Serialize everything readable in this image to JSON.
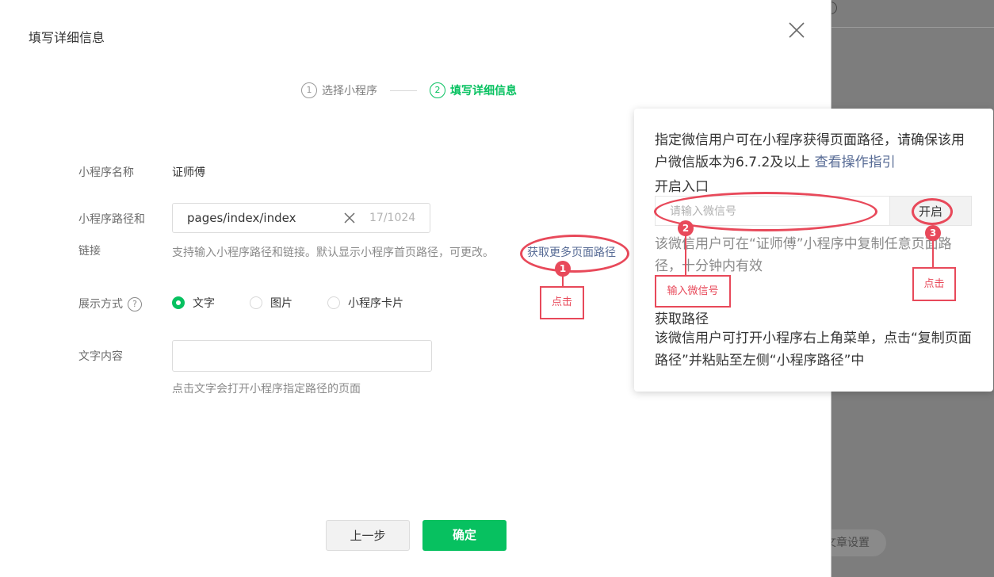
{
  "background": {
    "article_settings_label": "文章设置"
  },
  "dialog": {
    "title": "填写详细信息",
    "steps": [
      {
        "num": "1",
        "label": "选择小程序"
      },
      {
        "num": "2",
        "label": "填写详细信息"
      }
    ],
    "form": {
      "name_label": "小程序名称",
      "name_value": "证师傅",
      "path_label_line1": "小程序路径和",
      "path_label_line2": "链接",
      "path_value": "pages/index/index",
      "path_count": "17/1024",
      "path_hint": "支持输入小程序路径和链接。默认显示小程序首页路径，可更改。",
      "more_paths_link": "获取更多页面路径",
      "display_label": "展示方式",
      "display_options": [
        "文字",
        "图片",
        "小程序卡片"
      ],
      "display_selected": "文字",
      "text_label": "文字内容",
      "text_value": "",
      "text_hint": "点击文字会打开小程序指定路径的页面"
    },
    "buttons": {
      "prev": "上一步",
      "ok": "确定"
    }
  },
  "popover": {
    "desc_text": "指定微信用户可在小程序获得页面路径，请确保该用户微信版本为6.7.2及以上",
    "guide_link": "查看操作指引",
    "enable_heading": "开启入口",
    "wechat_placeholder": "请输入微信号",
    "enable_button": "开启",
    "enable_note": "该微信用户可在“证师傅”小程序中复制任意页面路径，十分钟内有效",
    "get_path_heading": "获取路径",
    "get_path_note": "该微信用户可打开小程序右上角菜单，点击“复制页面路径”并粘贴至左侧“小程序路径”中"
  },
  "annotations": {
    "color": "#e8495a",
    "items": [
      {
        "num": "1",
        "label": "点击"
      },
      {
        "num": "2",
        "label": "输入微信号"
      },
      {
        "num": "3",
        "label": "点击"
      }
    ]
  },
  "colors": {
    "primary_green": "#07c160",
    "link_blue": "#576b95"
  }
}
